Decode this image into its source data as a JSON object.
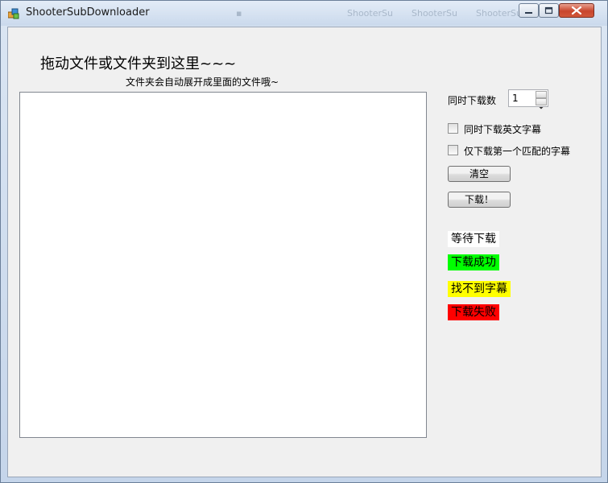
{
  "window": {
    "title": "ShooterSubDownloader"
  },
  "background_titles": [
    "ShooterSu",
    "ShooterSu",
    "ShooterSu"
  ],
  "drop": {
    "heading": "拖动文件或文件夹到这里~~~",
    "subheading": "文件夹会自动展开成里面的文件哦~"
  },
  "options": {
    "concurrent_label": "同时下载数",
    "concurrent_value": "1",
    "english_sub_label": "同时下载英文字幕",
    "first_match_label": "仅下载第一个匹配的字幕",
    "english_sub_checked": false,
    "first_match_checked": false
  },
  "buttons": {
    "clear": "清空",
    "download": "下载！"
  },
  "legend": [
    {
      "label": "等待下载",
      "color": "#ffffff"
    },
    {
      "label": "下载成功",
      "color": "#00ff00"
    },
    {
      "label": "找不到字幕",
      "color": "#ffff00"
    },
    {
      "label": "下载失败",
      "color": "#ff0000"
    }
  ]
}
